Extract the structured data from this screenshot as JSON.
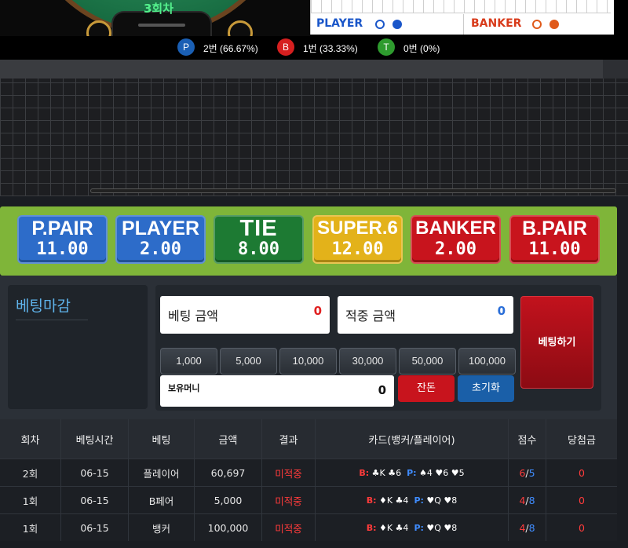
{
  "game": {
    "round_label": "3회차"
  },
  "legend": {
    "player": "PLAYER",
    "banker": "BANKER",
    "player_color": "#1a56c9",
    "banker_color": "#d83a1a"
  },
  "stats": [
    {
      "letter": "P",
      "text": "2번 (66.67%)",
      "color": "#1a5fb4"
    },
    {
      "letter": "B",
      "text": "1번 (33.33%)",
      "color": "#d61f1f"
    },
    {
      "letter": "T",
      "text": "0번 (0%)",
      "color": "#2e9b2e"
    }
  ],
  "bets": [
    {
      "name": "P.PAIR",
      "odds": "11.00",
      "color": "#2d6cc9"
    },
    {
      "name": "PLAYER",
      "odds": "2.00",
      "color": "#2d6cc9"
    },
    {
      "name": "TIE",
      "odds": "8.00",
      "color": "#1d7a33"
    },
    {
      "name": "SUPER.6",
      "odds": "12.00",
      "color": "#e3b21a"
    },
    {
      "name": "BANKER",
      "odds": "2.00",
      "color": "#c8141d"
    },
    {
      "name": "B.PAIR",
      "odds": "11.00",
      "color": "#c8141d"
    }
  ],
  "betting": {
    "status_title": "베팅마감",
    "bet_amount_label": "베팅 금액",
    "bet_amount_value": "0",
    "win_amount_label": "적중 금액",
    "win_amount_value": "0",
    "chips": [
      "1,000",
      "5,000",
      "10,000",
      "30,000",
      "50,000",
      "100,000"
    ],
    "balance_label": "보유머니",
    "balance_value": "0",
    "change_label": "잔돈",
    "reset_label": "초기화",
    "submit_label": "베팅하기"
  },
  "history": {
    "headers": [
      "회차",
      "베팅시간",
      "베팅",
      "금액",
      "결과",
      "카드(뱅커/플레이어)",
      "점수",
      "당첨금"
    ],
    "rows": [
      {
        "round": "2회",
        "time": "06-15",
        "bet": "플레이어",
        "amount": "60,697",
        "result": "미적중",
        "b_cards": "♣K ♣6",
        "p_cards": "♠4 ♥6 ♥5",
        "b_score": "6",
        "p_score": "5",
        "payout": "0"
      },
      {
        "round": "1회",
        "time": "06-15",
        "bet": "B페어",
        "amount": "5,000",
        "result": "미적중",
        "b_cards": "♦K ♣4",
        "p_cards": "♥Q ♥8",
        "b_score": "4",
        "p_score": "8",
        "payout": "0"
      },
      {
        "round": "1회",
        "time": "06-15",
        "bet": "뱅커",
        "amount": "100,000",
        "result": "미적중",
        "b_cards": "♦K ♣4",
        "p_cards": "♥Q ♥8",
        "b_score": "4",
        "p_score": "8",
        "payout": "0"
      }
    ]
  }
}
